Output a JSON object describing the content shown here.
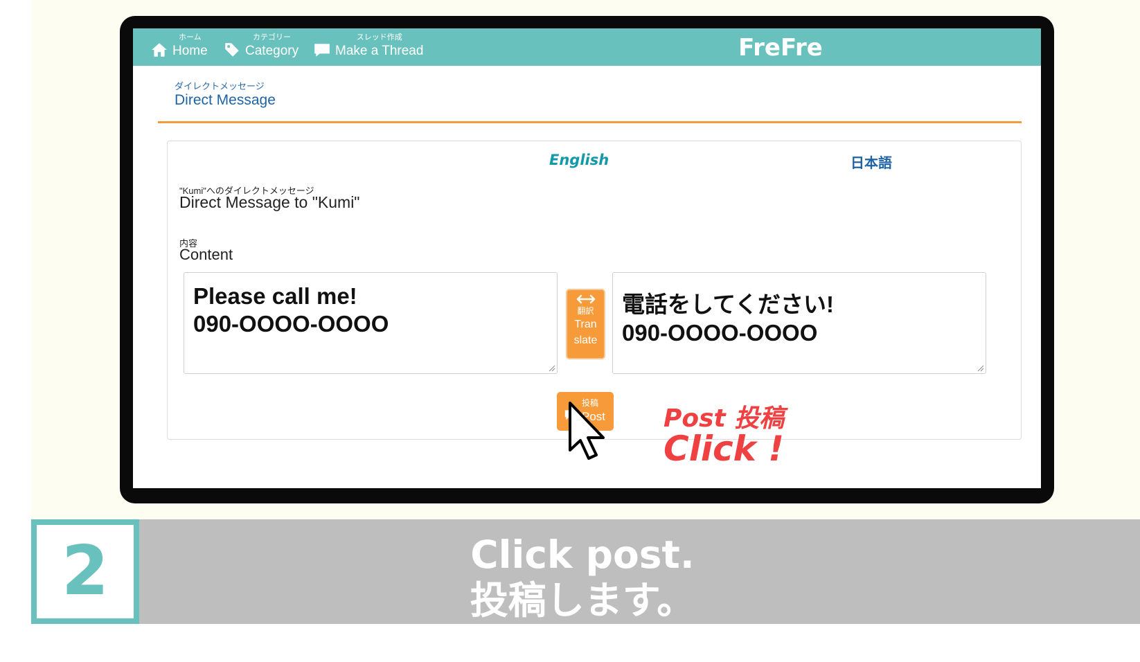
{
  "nav": {
    "home": {
      "small": "ホーム",
      "label": "Home",
      "icon": "home-icon"
    },
    "category": {
      "small": "カテゴリー",
      "label": "Category",
      "icon": "tag-icon"
    },
    "thread": {
      "small": "スレッド作成",
      "label": "Make a Thread",
      "icon": "speech-bubble-icon"
    },
    "brand": "FreFre"
  },
  "page": {
    "title_small": "ダイレクトメッセージ",
    "title": "Direct Message"
  },
  "form": {
    "lang_en": "English",
    "lang_ja": "日本語",
    "to_small": "\"Kumi\"へのダイレクトメッセージ",
    "to_label": "Direct Message to \"Kumi\"",
    "content_small": "内容",
    "content_label": "Content",
    "content_en": [
      "Please call me!",
      "090-OOOO-OOOO"
    ],
    "content_ja": [
      "電話をしてください!",
      "090-OOOO-OOOO"
    ],
    "translate": {
      "small": "翻訳",
      "label_line1": "Tran",
      "label_line2": "slate",
      "icon": "swap-arrows-icon"
    },
    "post": {
      "small": "投稿",
      "label": "Post",
      "icon": "speech-bubble-icon"
    }
  },
  "callout": {
    "line1": "Post 投稿",
    "line2": "Click !"
  },
  "step": {
    "number": "2",
    "line1": "Click post.",
    "line2": "投稿します。"
  },
  "colors": {
    "nav": "#69c1bd",
    "accent_orange": "#f79b3a",
    "callout_red": "#ef4142",
    "link_blue": "#1f63a5",
    "step_bar": "#bebebe"
  }
}
